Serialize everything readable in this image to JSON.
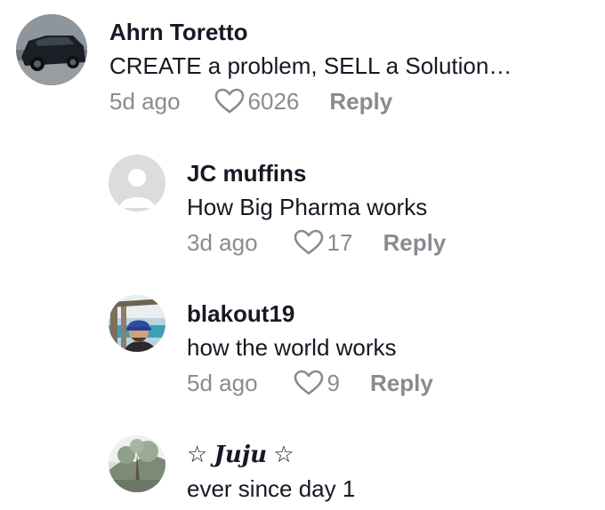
{
  "comments": [
    {
      "username": "Ahrn Toretto",
      "text": "CREATE a problem, SELL a Solution…",
      "time": "5d ago",
      "likes": "6026",
      "reply_label": "Reply",
      "avatar": "car-photo"
    },
    {
      "username": "JC muffins",
      "text": "How Big Pharma works",
      "time": "3d ago",
      "likes": "17",
      "reply_label": "Reply",
      "avatar": "default-avatar"
    },
    {
      "username": "blakout19",
      "text": "how the world works",
      "time": "5d ago",
      "likes": "9",
      "reply_label": "Reply",
      "avatar": "beach-selfie"
    },
    {
      "username_star_left": "☆",
      "username": "Juju",
      "username_star_right": "☆",
      "text": "ever since day 1",
      "avatar": "tree-photo"
    }
  ],
  "colors": {
    "text": "#161823",
    "muted": "#8a8b91",
    "background": "#ffffff"
  }
}
